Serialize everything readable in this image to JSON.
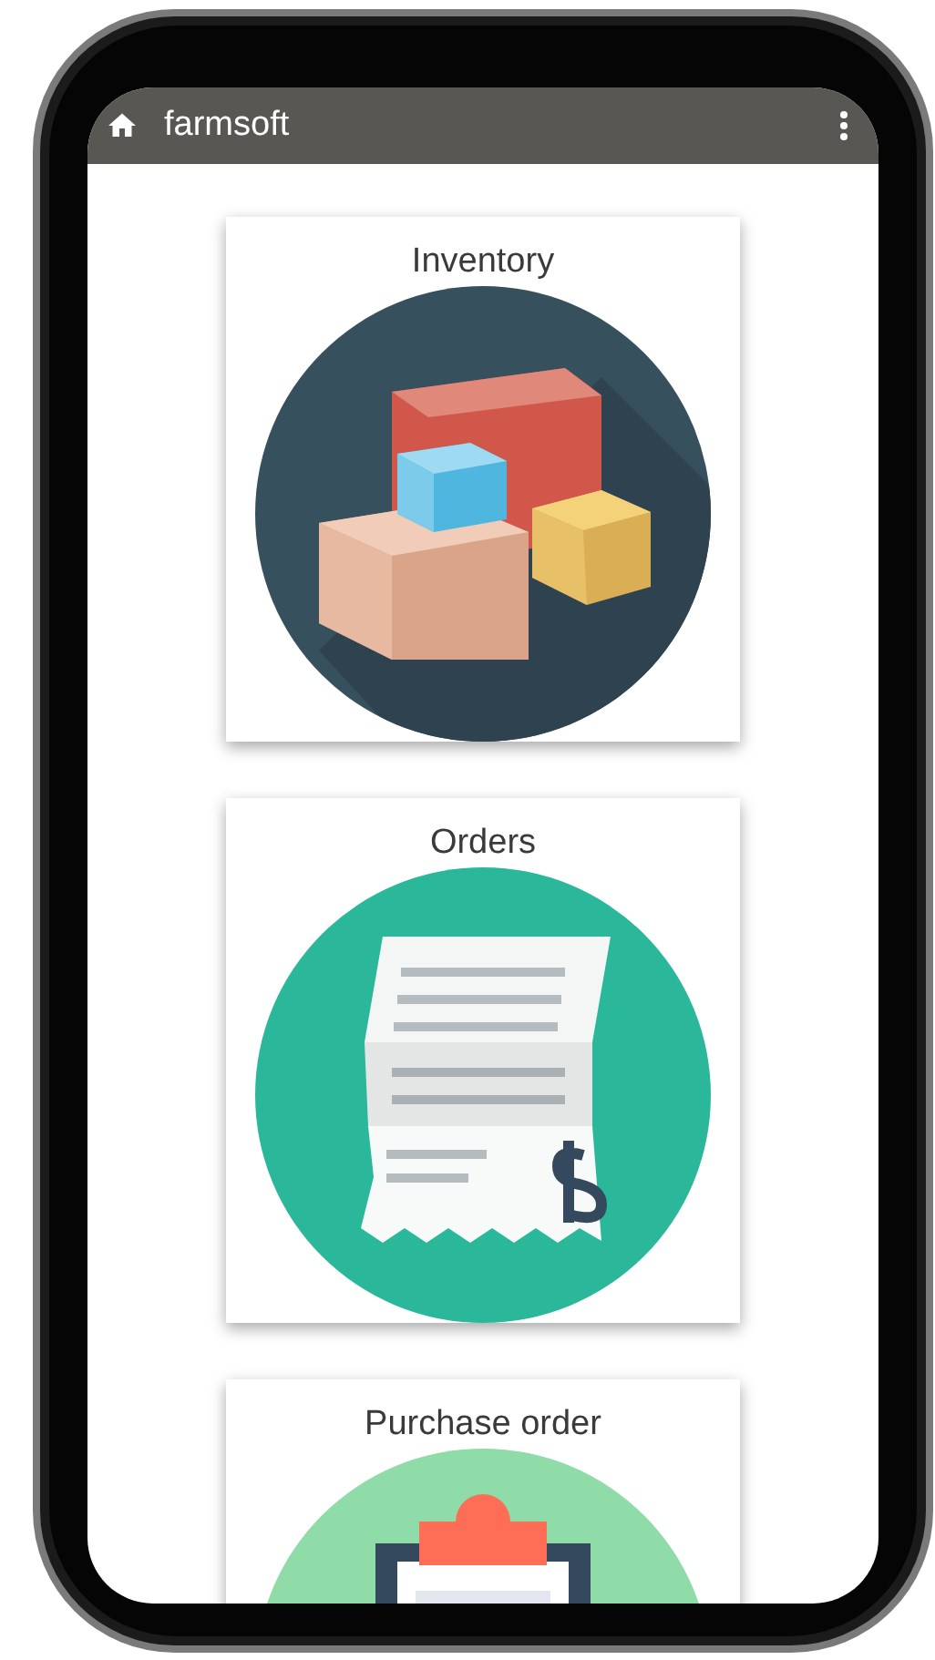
{
  "app_bar": {
    "title": "farmsoft"
  },
  "tiles": [
    {
      "kind": "inventory",
      "label": "Inventory"
    },
    {
      "kind": "orders",
      "label": "Orders"
    },
    {
      "kind": "purchase_order",
      "label": "Purchase order"
    }
  ]
}
